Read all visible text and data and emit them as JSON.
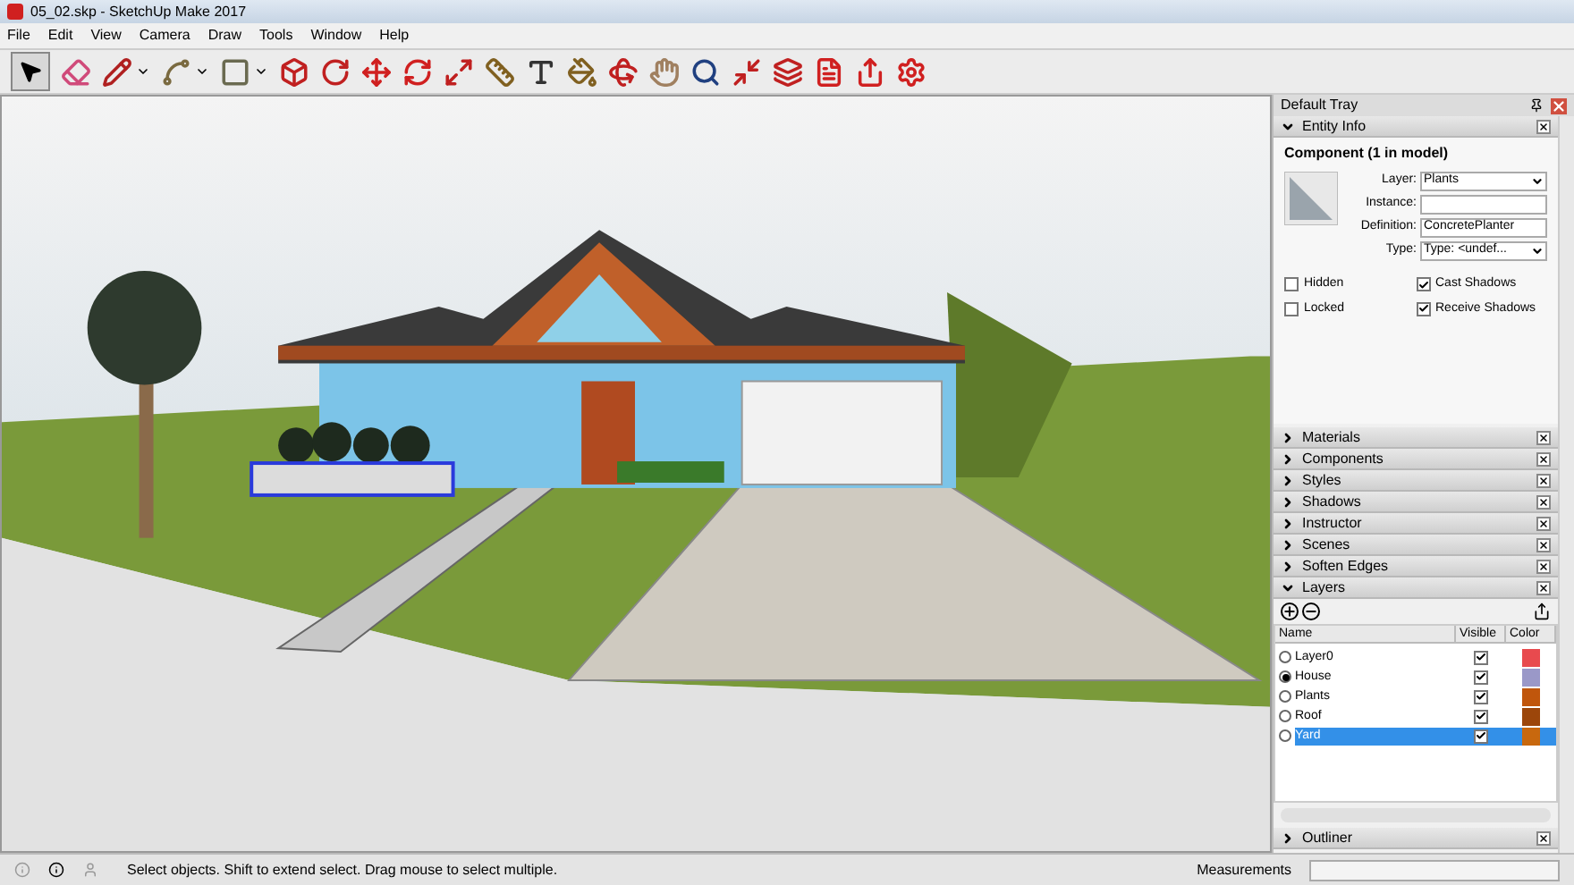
{
  "window": {
    "title": "05_02.skp - SketchUp Make 2017"
  },
  "menu": [
    "File",
    "Edit",
    "View",
    "Camera",
    "Draw",
    "Tools",
    "Window",
    "Help"
  ],
  "tray": {
    "title": "Default Tray",
    "entity_info": {
      "title": "Entity Info",
      "expanded": true,
      "heading": "Component (1 in model)",
      "fields": [
        {
          "label": "Layer:",
          "value": "Plants",
          "kind": "dropdown"
        },
        {
          "label": "Instance:",
          "kind": "text"
        },
        {
          "label": "Definition:",
          "value": "ConcretePlanter",
          "kind": "text"
        },
        {
          "label": "Type:",
          "value": "Type: <undef...",
          "kind": "dropdown"
        }
      ],
      "checkboxes": [
        {
          "label": "Hidden",
          "checked": false
        },
        {
          "label": "Cast Shadows",
          "checked": true
        },
        {
          "label": "Locked",
          "checked": false
        },
        {
          "label": "Receive Shadows",
          "checked": true
        }
      ]
    },
    "panels": [
      {
        "title": "Materials",
        "expanded": false
      },
      {
        "title": "Components",
        "expanded": false
      },
      {
        "title": "Styles",
        "expanded": false
      },
      {
        "title": "Shadows",
        "expanded": false
      },
      {
        "title": "Instructor",
        "expanded": false
      },
      {
        "title": "Scenes",
        "expanded": false
      },
      {
        "title": "Soften Edges",
        "expanded": false
      },
      {
        "title": "Layers",
        "expanded": true
      }
    ],
    "layers": {
      "columns": [
        "Name",
        "Visible",
        "Color"
      ],
      "rows": [
        {
          "name": "Layer0",
          "current": false,
          "visible": true,
          "color": "#e84a4e",
          "selected": false
        },
        {
          "name": "House",
          "current": true,
          "visible": true,
          "color": "#9a98c8",
          "selected": false
        },
        {
          "name": "Plants",
          "current": false,
          "visible": true,
          "color": "#c0560c",
          "selected": false
        },
        {
          "name": "Roof",
          "current": false,
          "visible": true,
          "color": "#9c460a",
          "selected": false
        },
        {
          "name": "Yard",
          "current": false,
          "visible": true,
          "color": "#c8680e",
          "selected": true
        }
      ]
    },
    "bottom_panel": {
      "title": "Outliner",
      "expanded": false
    }
  },
  "status_bar": {
    "message": "Select objects. Shift to extend select. Drag mouse to select multiple.",
    "measurements_label": "Measurements"
  }
}
